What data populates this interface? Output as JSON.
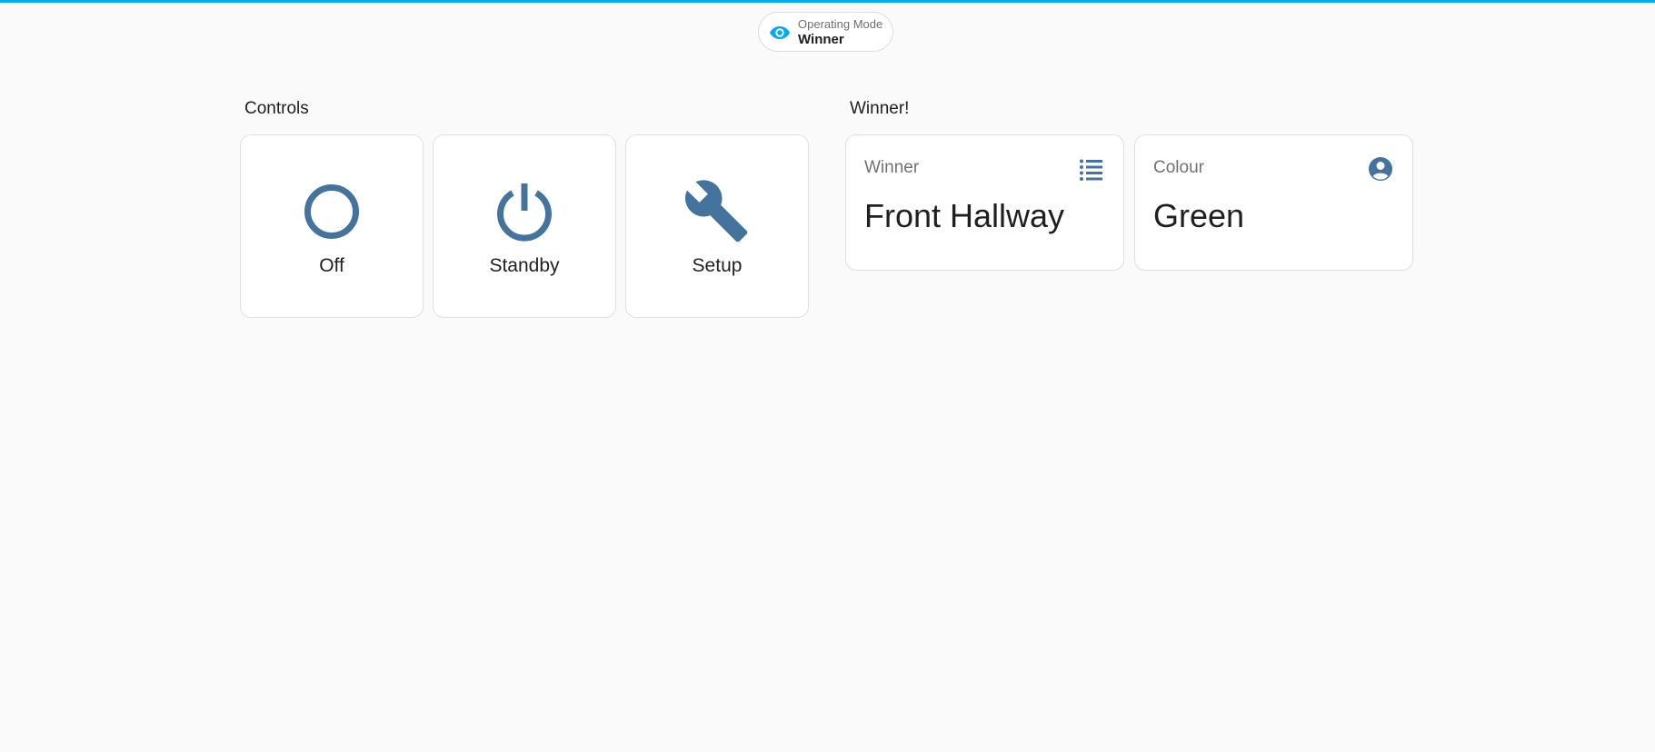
{
  "header": {
    "operating_mode": {
      "label": "Operating Mode",
      "value": "Winner",
      "icon": "eye-icon"
    }
  },
  "colors": {
    "accent": "#03a9f4",
    "icon": "#44739e",
    "text_primary": "#1f1f1f",
    "text_secondary": "#727272",
    "card_bg": "#ffffff",
    "page_bg": "#fafafa"
  },
  "controls": {
    "title": "Controls",
    "buttons": [
      {
        "label": "Off",
        "icon": "circle-outline-icon"
      },
      {
        "label": "Standby",
        "icon": "power-icon"
      },
      {
        "label": "Setup",
        "icon": "wrench-icon"
      }
    ]
  },
  "winner_section": {
    "title": "Winner!",
    "tiles": [
      {
        "name": "Winner",
        "value": "Front Hallway",
        "icon": "list-icon"
      },
      {
        "name": "Colour",
        "value": "Green",
        "icon": "account-circle-icon"
      }
    ]
  }
}
